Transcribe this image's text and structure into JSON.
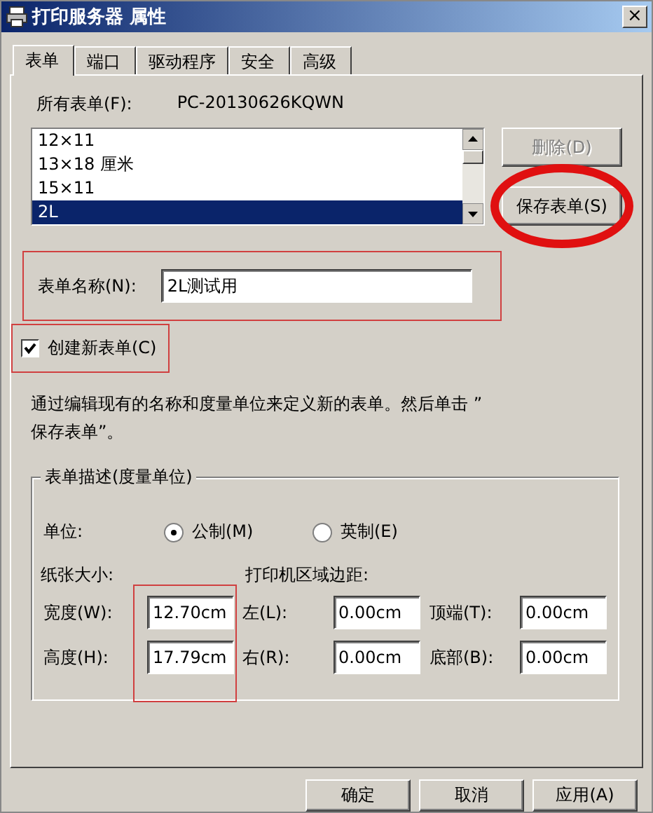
{
  "window": {
    "title": "打印服务器 属性",
    "close": "×"
  },
  "tabs": [
    {
      "label": "表单",
      "selected": true
    },
    {
      "label": "端口",
      "selected": false
    },
    {
      "label": "驱动程序",
      "selected": false
    },
    {
      "label": "安全",
      "selected": false
    },
    {
      "label": "高级",
      "selected": false
    }
  ],
  "all_forms": {
    "label": "所有表单(F):",
    "server": "PC-20130626KQWN"
  },
  "forms_list": [
    {
      "label": "12×11",
      "selected": false
    },
    {
      "label": "13×18 厘米",
      "selected": false
    },
    {
      "label": "15×11",
      "selected": false
    },
    {
      "label": "2L",
      "selected": true
    }
  ],
  "side_buttons": [
    {
      "label": "删除(D)",
      "disabled": true,
      "circled": false
    },
    {
      "label": "保存表单(S)",
      "disabled": false,
      "circled": true
    }
  ],
  "form_name": {
    "label": "表单名称(N):",
    "value": "2L测试用",
    "boxed": true
  },
  "create_new": {
    "label": "创建新表单(C)",
    "checked": true,
    "boxed": true
  },
  "description": "通过编辑现有的名称和度量单位来定义新的表单。然后单击 ” 保存表单”。",
  "group": {
    "title": "表单描述(度量单位)",
    "units_label": "单位:",
    "units": [
      {
        "label": "公制(M)",
        "selected": true
      },
      {
        "label": "英制(E)",
        "selected": false
      }
    ],
    "paper_size_label": "纸张大小:",
    "margins_label": "打印机区域边距:",
    "size_boxed": true,
    "rows": [
      {
        "size_label": "宽度(W):",
        "size_value": "12.70cm",
        "m1_label": "左(L):",
        "m1_value": "0.00cm",
        "m2_label": "顶端(T):",
        "m2_value": "0.00cm"
      },
      {
        "size_label": "高度(H):",
        "size_value": "17.79cm",
        "m1_label": "右(R):",
        "m1_value": "0.00cm",
        "m2_label": "底部(B):",
        "m2_value": "0.00cm"
      }
    ]
  },
  "buttons": [
    {
      "label": "确定"
    },
    {
      "label": "取消"
    },
    {
      "label": "应用(A)"
    }
  ]
}
